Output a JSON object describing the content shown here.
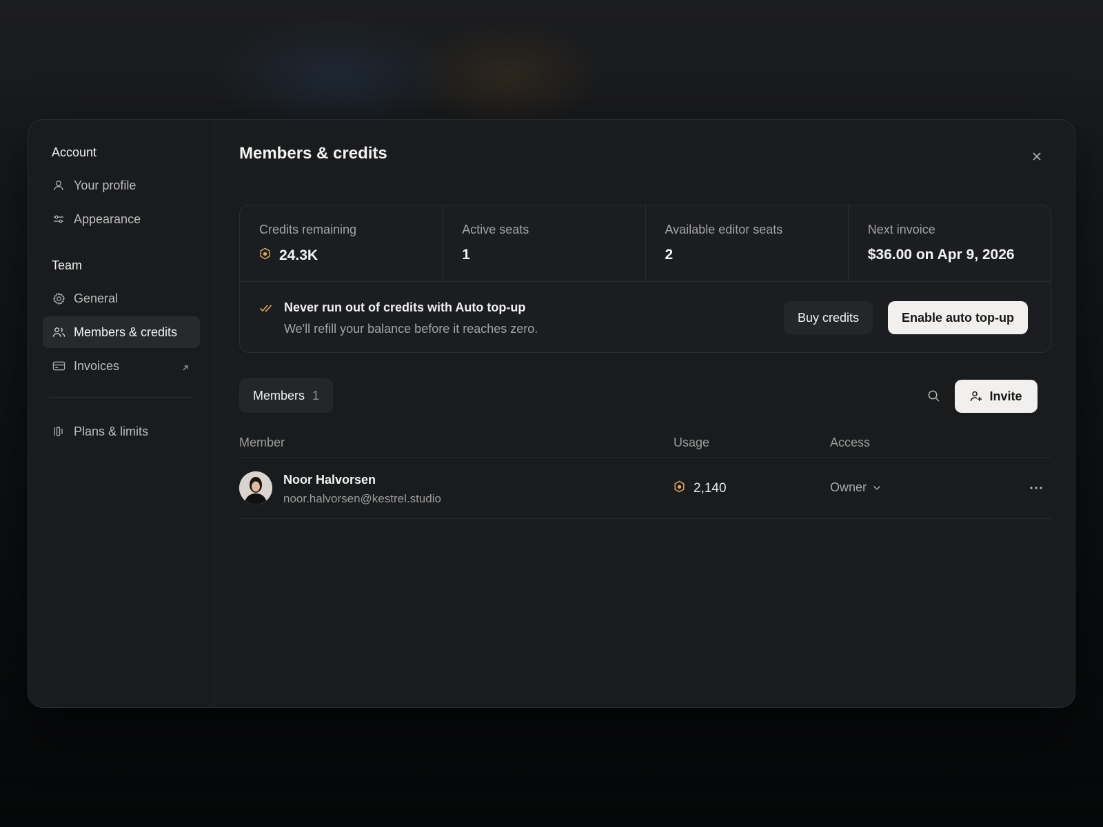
{
  "sidebar": {
    "account_title": "Account",
    "account_items": [
      {
        "label": "Your profile",
        "icon": "user-icon"
      },
      {
        "label": "Appearance",
        "icon": "sliders-icon"
      }
    ],
    "team_title": "Team",
    "team_items": [
      {
        "label": "General",
        "icon": "gear-icon"
      },
      {
        "label": "Members & credits",
        "icon": "users-icon",
        "active": true
      },
      {
        "label": "Invoices",
        "icon": "credit-card-icon",
        "external": true
      }
    ],
    "bottom_items": [
      {
        "label": "Plans & limits",
        "icon": "bars-icon"
      }
    ]
  },
  "main": {
    "title": "Members & credits",
    "stats": [
      {
        "label": "Credits remaining",
        "value": "24.3K",
        "icon": "coin-icon"
      },
      {
        "label": "Active seats",
        "value": "1"
      },
      {
        "label": "Available editor seats",
        "value": "2"
      },
      {
        "label": "Next invoice",
        "value": "$36.00 on Apr 9, 2026"
      }
    ],
    "topup": {
      "title": "Never run out of credits with Auto top-up",
      "subtitle": "We'll refill your balance before it reaches zero.",
      "buy_label": "Buy credits",
      "enable_label": "Enable auto top-up"
    },
    "members_tab": {
      "label": "Members",
      "count": "1"
    },
    "invite_label": "Invite",
    "table": {
      "headers": {
        "member": "Member",
        "usage": "Usage",
        "access": "Access"
      },
      "rows": [
        {
          "name": "Noor Halvorsen",
          "email": "noor.halvorsen@kestrel.studio",
          "usage": "2,140",
          "access": "Owner"
        }
      ]
    }
  },
  "colors": {
    "accent_coin": "#e0a85a",
    "background": "#191b1d",
    "primary_button": "#f1f0ee"
  }
}
